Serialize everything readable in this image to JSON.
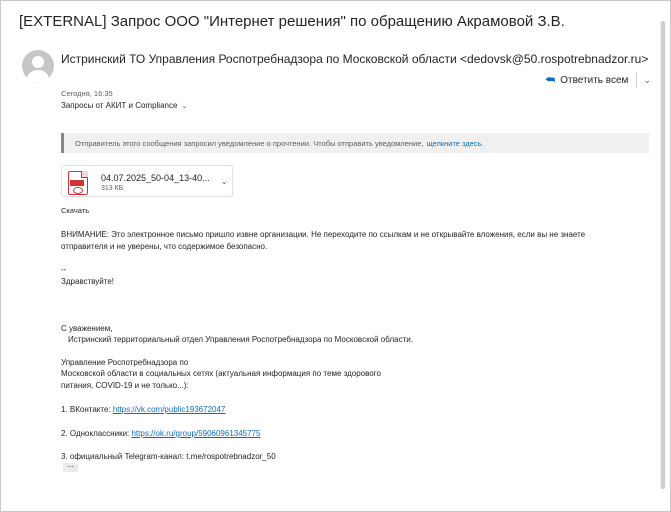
{
  "subject": "[EXTERNAL] Запрос ООО \"Интернет решения\" по обращению Акрамовой З.В.",
  "sender": "Истринский ТО Управления Роспотребнадзора по Московской области <dedovsk@50.rospotrebnadzor.ru>",
  "reply_all_label": "Ответить всем",
  "date": "Сегодня, 16:35",
  "recipients": "Запросы от АКИТ и Compliance",
  "notice": {
    "text": "Отправитель этого сообщения запросил уведомление о прочтении. Чтобы отправить уведомление,",
    "link": "щелкните здесь."
  },
  "attachment": {
    "name": "04.07.2025_50-04_13-40...",
    "size": "313 КБ"
  },
  "download_label": "Скачать",
  "body": {
    "warning_line1": "ВНИМАНИЕ: Это электронное письмо пришло извне организации. Не переходите по ссылкам и не открывайте вложения, если вы не знаете",
    "warning_line2": "отправителя и не уверены, что содержимое безопасно.",
    "dashes": "--",
    "greeting": "Здравствуйте!",
    "regards": "С уважением,",
    "dept": "Истринский территориальный отдел Управления Роспотребнадзора по Московской области.",
    "social1": "Управление Роспотребнадзора по",
    "social2": "Московской области в социальных сетях (актуальная информация по теме здорового",
    "social3": "питания, COVID-19 и не только...):",
    "vk_label": "1.  ВКонтакте: ",
    "vk_link": "https://vk.com/public193672047",
    "ok_label": "2.  Одноклассники: ",
    "ok_link": "https://ok.ru/group/59060961345775",
    "tg": "3.  официальный Telegram-канал: t.me/rospotrebnadzor_50",
    "more": "..."
  },
  "colors": {
    "accent": "#0f6cbd",
    "pdf": "#d13438"
  }
}
